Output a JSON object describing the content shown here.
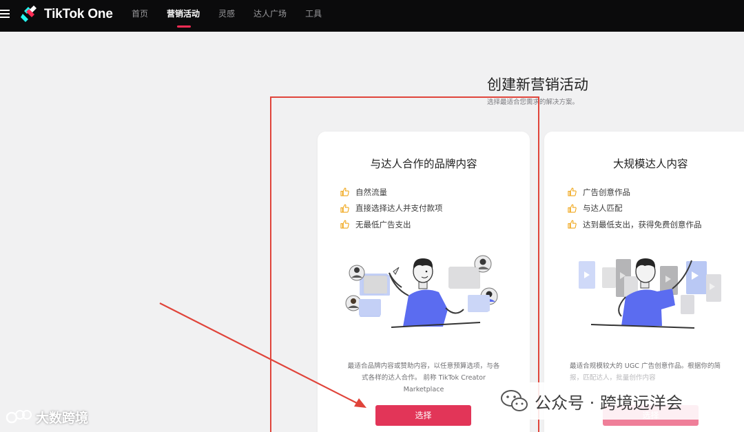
{
  "app": {
    "logo_text": "TikTok One",
    "nav": [
      "首页",
      "营销活动",
      "灵感",
      "达人广场",
      "工具"
    ],
    "active_nav": "营销活动"
  },
  "header": {
    "title": "创建新营销活动",
    "subtitle": "选择最适合您需求的解决方案。"
  },
  "cards": [
    {
      "title": "与达人合作的品牌内容",
      "features": [
        "自然流量",
        "直接选择达人并支付款项",
        "无最低广告支出"
      ],
      "desc_lines": [
        "最适合品牌内容或赞助内容，以任意预算选项，与各",
        "式各样的达人合作。 前称 TikTok Creator",
        "Marketplace"
      ],
      "button_label": "选择"
    },
    {
      "title": "大规模达人内容",
      "features": [
        "广告创意作品",
        "与达人匹配",
        "达到最低支出，获得免费创意作品"
      ],
      "desc_lines": [
        "最适合规模较大的 UGC 广告创意作品。根据你的简",
        "报，匹配达人，批量创作内容"
      ],
      "button_label": "选择"
    }
  ],
  "watermarks": {
    "left": "大数跨境",
    "right": "公众号 · 跨境远洋会"
  },
  "colors": {
    "accent": "#fe2c55",
    "button": "#e23558",
    "highlight": "#e0443a",
    "avatar_shirt": "#5b6cf0"
  }
}
